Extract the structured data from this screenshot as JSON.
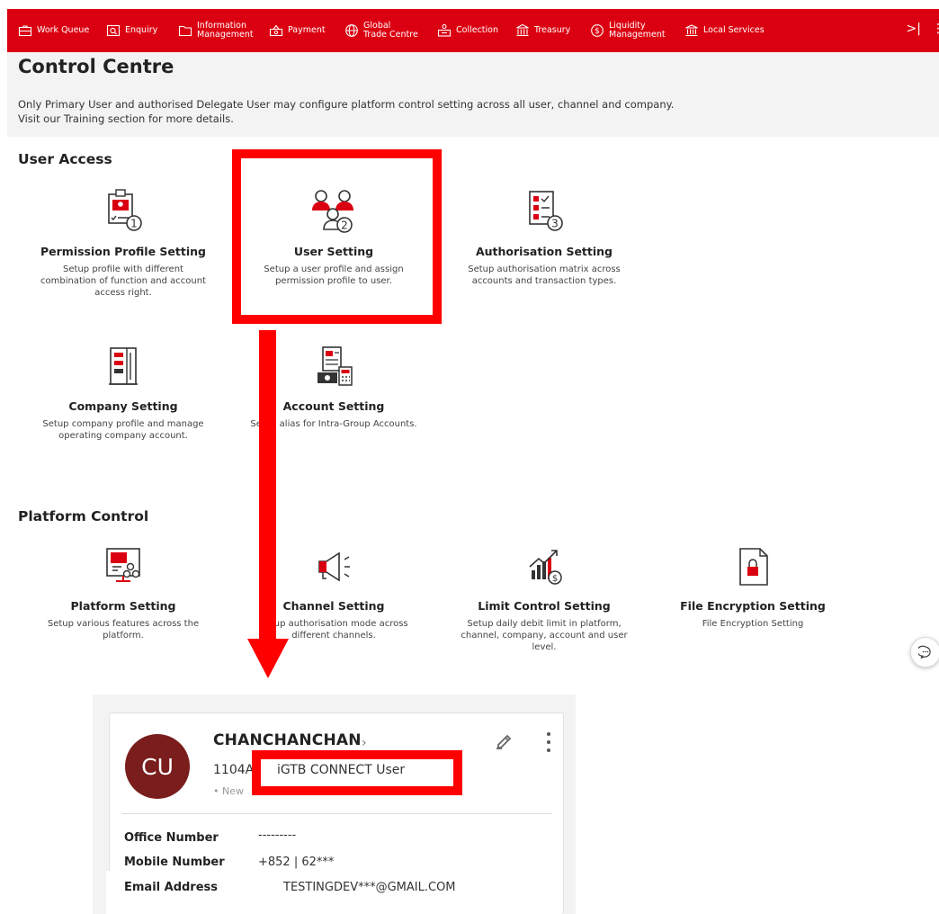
{
  "nav": {
    "items": [
      {
        "label1": "Work Queue",
        "label2": ""
      },
      {
        "label1": "Enquiry",
        "label2": ""
      },
      {
        "label1": "Information",
        "label2": "Management"
      },
      {
        "label1": "Payment",
        "label2": ""
      },
      {
        "label1": "Global",
        "label2": "Trade Centre"
      },
      {
        "label1": "Collection",
        "label2": ""
      },
      {
        "label1": "Treasury",
        "label2": ""
      },
      {
        "label1": "Liquidity",
        "label2": "Management"
      },
      {
        "label1": "Local Services",
        "label2": ""
      }
    ],
    "collapse_glyph": ">|",
    "more_glyph": "⋮"
  },
  "page": {
    "title": "Control Centre",
    "desc_line1": "Only Primary User and authorised Delegate User may configure platform control setting across all user, channel and company.",
    "desc_line2": "Visit our Training section for more details."
  },
  "user_access": {
    "title": "User Access",
    "tiles": [
      {
        "title": "Permission Profile Setting",
        "desc": "Setup profile with different combination of function and account access right.",
        "icon": "permission-profile-icon",
        "step": "1"
      },
      {
        "title": "User Setting",
        "desc": "Setup a user profile and assign permission profile to user.",
        "icon": "user-group-icon",
        "step": "2"
      },
      {
        "title": "Authorisation Setting",
        "desc": "Setup authorisation matrix across accounts and transaction types.",
        "icon": "checklist-icon",
        "step": "3"
      },
      {
        "title": "Company Setting",
        "desc": "Setup company profile and manage operating company account.",
        "icon": "building-icon"
      },
      {
        "title": "Account Setting",
        "desc": "Setup alias for Intra-Group Accounts.",
        "icon": "account-calculator-icon"
      }
    ]
  },
  "platform_control": {
    "title": "Platform Control",
    "tiles": [
      {
        "title": "Platform Setting",
        "desc": "Setup various features across the platform.",
        "icon": "platform-monitor-icon"
      },
      {
        "title": "Channel Setting",
        "desc": "Setup authorisation mode across different channels.",
        "icon": "megaphone-icon"
      },
      {
        "title": "Limit Control Setting",
        "desc": "Setup daily debit limit in platform, channel, company, account and user level.",
        "icon": "growth-chart-icon"
      },
      {
        "title": "File Encryption Setting",
        "desc": "File Encryption Setting",
        "icon": "file-lock-icon"
      }
    ]
  },
  "user_card": {
    "initials": "CU",
    "name": "CHANCHANCHAN",
    "chevron": "›",
    "user_id": "1104A",
    "role": "iGTB CONNECT User",
    "status": "• New",
    "fields": [
      {
        "label": "Office Number",
        "value": "---------"
      },
      {
        "label": "Mobile Number",
        "value": "+852 | 62***"
      },
      {
        "label": "Email Address",
        "value": "TESTINGDEV***@GMAIL.COM"
      }
    ]
  },
  "colors": {
    "brand_red": "#db0011",
    "annotation_red": "#ff0000",
    "avatar": "#7a1d1d"
  }
}
